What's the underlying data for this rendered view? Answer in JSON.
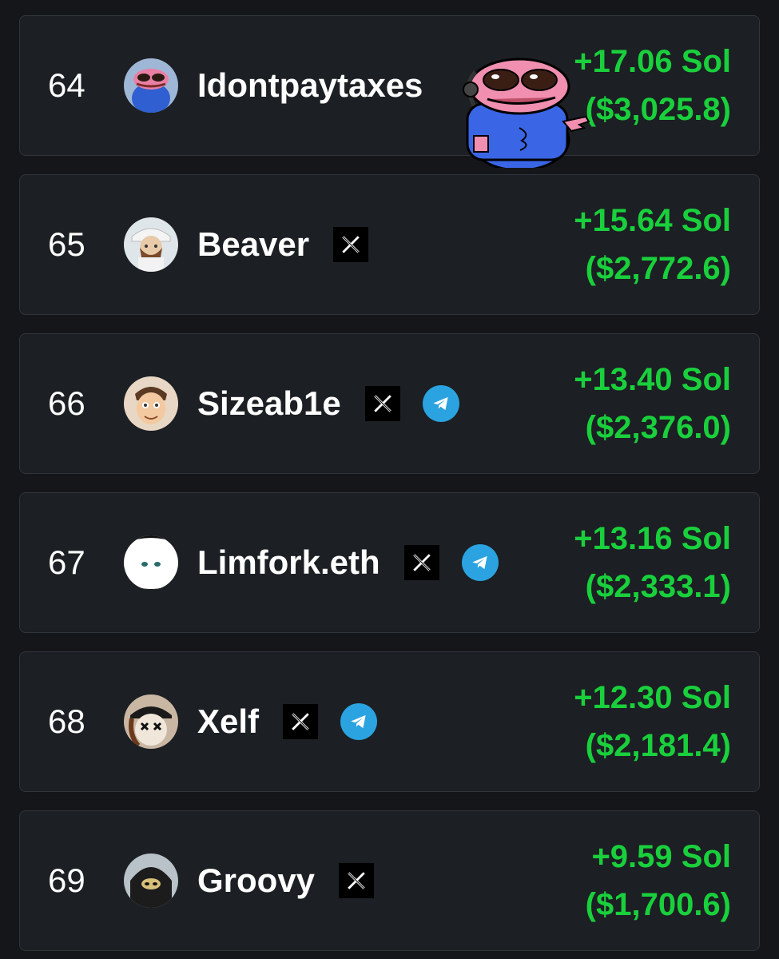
{
  "leaderboard": {
    "rows": [
      {
        "rank": "64",
        "name": "Idontpaytaxes",
        "sol": "+17.06 Sol",
        "usd": "($3,025.8)",
        "x_icon": false,
        "telegram_icon": false
      },
      {
        "rank": "65",
        "name": "Beaver",
        "sol": "+15.64 Sol",
        "usd": "($2,772.6)",
        "x_icon": true,
        "telegram_icon": false
      },
      {
        "rank": "66",
        "name": "Sizeab1e",
        "sol": "+13.40 Sol",
        "usd": "($2,376.0)",
        "x_icon": true,
        "telegram_icon": true
      },
      {
        "rank": "67",
        "name": "Limfork.eth",
        "sol": "+13.16 Sol",
        "usd": "($2,333.1)",
        "x_icon": true,
        "telegram_icon": true
      },
      {
        "rank": "68",
        "name": "Xelf",
        "sol": "+12.30 Sol",
        "usd": "($2,181.4)",
        "x_icon": true,
        "telegram_icon": true
      },
      {
        "rank": "69",
        "name": "Groovy",
        "sol": "+9.59 Sol",
        "usd": "($1,700.6)",
        "x_icon": true,
        "telegram_icon": false
      }
    ]
  },
  "colors": {
    "background": "#141619",
    "card": "#1c1f23",
    "card_border": "#30353b",
    "profit": "#19d03c",
    "telegram": "#2aa3e0"
  },
  "icons": [
    "x-logo-icon",
    "telegram-icon",
    "pepe-sticker"
  ]
}
